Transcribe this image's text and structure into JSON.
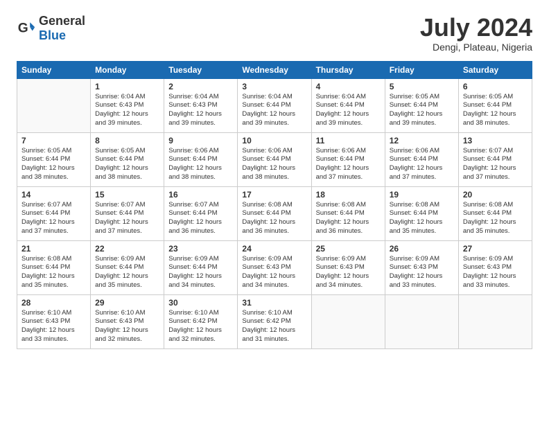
{
  "header": {
    "logo_general": "General",
    "logo_blue": "Blue",
    "main_title": "July 2024",
    "subtitle": "Dengi, Plateau, Nigeria"
  },
  "calendar": {
    "weekdays": [
      "Sunday",
      "Monday",
      "Tuesday",
      "Wednesday",
      "Thursday",
      "Friday",
      "Saturday"
    ],
    "weeks": [
      [
        {
          "day": "",
          "info": ""
        },
        {
          "day": "1",
          "info": "Sunrise: 6:04 AM\nSunset: 6:43 PM\nDaylight: 12 hours\nand 39 minutes."
        },
        {
          "day": "2",
          "info": "Sunrise: 6:04 AM\nSunset: 6:43 PM\nDaylight: 12 hours\nand 39 minutes."
        },
        {
          "day": "3",
          "info": "Sunrise: 6:04 AM\nSunset: 6:44 PM\nDaylight: 12 hours\nand 39 minutes."
        },
        {
          "day": "4",
          "info": "Sunrise: 6:04 AM\nSunset: 6:44 PM\nDaylight: 12 hours\nand 39 minutes."
        },
        {
          "day": "5",
          "info": "Sunrise: 6:05 AM\nSunset: 6:44 PM\nDaylight: 12 hours\nand 39 minutes."
        },
        {
          "day": "6",
          "info": "Sunrise: 6:05 AM\nSunset: 6:44 PM\nDaylight: 12 hours\nand 38 minutes."
        }
      ],
      [
        {
          "day": "7",
          "info": "Sunrise: 6:05 AM\nSunset: 6:44 PM\nDaylight: 12 hours\nand 38 minutes."
        },
        {
          "day": "8",
          "info": "Sunrise: 6:05 AM\nSunset: 6:44 PM\nDaylight: 12 hours\nand 38 minutes."
        },
        {
          "day": "9",
          "info": "Sunrise: 6:06 AM\nSunset: 6:44 PM\nDaylight: 12 hours\nand 38 minutes."
        },
        {
          "day": "10",
          "info": "Sunrise: 6:06 AM\nSunset: 6:44 PM\nDaylight: 12 hours\nand 38 minutes."
        },
        {
          "day": "11",
          "info": "Sunrise: 6:06 AM\nSunset: 6:44 PM\nDaylight: 12 hours\nand 37 minutes."
        },
        {
          "day": "12",
          "info": "Sunrise: 6:06 AM\nSunset: 6:44 PM\nDaylight: 12 hours\nand 37 minutes."
        },
        {
          "day": "13",
          "info": "Sunrise: 6:07 AM\nSunset: 6:44 PM\nDaylight: 12 hours\nand 37 minutes."
        }
      ],
      [
        {
          "day": "14",
          "info": "Sunrise: 6:07 AM\nSunset: 6:44 PM\nDaylight: 12 hours\nand 37 minutes."
        },
        {
          "day": "15",
          "info": "Sunrise: 6:07 AM\nSunset: 6:44 PM\nDaylight: 12 hours\nand 37 minutes."
        },
        {
          "day": "16",
          "info": "Sunrise: 6:07 AM\nSunset: 6:44 PM\nDaylight: 12 hours\nand 36 minutes."
        },
        {
          "day": "17",
          "info": "Sunrise: 6:08 AM\nSunset: 6:44 PM\nDaylight: 12 hours\nand 36 minutes."
        },
        {
          "day": "18",
          "info": "Sunrise: 6:08 AM\nSunset: 6:44 PM\nDaylight: 12 hours\nand 36 minutes."
        },
        {
          "day": "19",
          "info": "Sunrise: 6:08 AM\nSunset: 6:44 PM\nDaylight: 12 hours\nand 35 minutes."
        },
        {
          "day": "20",
          "info": "Sunrise: 6:08 AM\nSunset: 6:44 PM\nDaylight: 12 hours\nand 35 minutes."
        }
      ],
      [
        {
          "day": "21",
          "info": "Sunrise: 6:08 AM\nSunset: 6:44 PM\nDaylight: 12 hours\nand 35 minutes."
        },
        {
          "day": "22",
          "info": "Sunrise: 6:09 AM\nSunset: 6:44 PM\nDaylight: 12 hours\nand 35 minutes."
        },
        {
          "day": "23",
          "info": "Sunrise: 6:09 AM\nSunset: 6:44 PM\nDaylight: 12 hours\nand 34 minutes."
        },
        {
          "day": "24",
          "info": "Sunrise: 6:09 AM\nSunset: 6:43 PM\nDaylight: 12 hours\nand 34 minutes."
        },
        {
          "day": "25",
          "info": "Sunrise: 6:09 AM\nSunset: 6:43 PM\nDaylight: 12 hours\nand 34 minutes."
        },
        {
          "day": "26",
          "info": "Sunrise: 6:09 AM\nSunset: 6:43 PM\nDaylight: 12 hours\nand 33 minutes."
        },
        {
          "day": "27",
          "info": "Sunrise: 6:09 AM\nSunset: 6:43 PM\nDaylight: 12 hours\nand 33 minutes."
        }
      ],
      [
        {
          "day": "28",
          "info": "Sunrise: 6:10 AM\nSunset: 6:43 PM\nDaylight: 12 hours\nand 33 minutes."
        },
        {
          "day": "29",
          "info": "Sunrise: 6:10 AM\nSunset: 6:43 PM\nDaylight: 12 hours\nand 32 minutes."
        },
        {
          "day": "30",
          "info": "Sunrise: 6:10 AM\nSunset: 6:42 PM\nDaylight: 12 hours\nand 32 minutes."
        },
        {
          "day": "31",
          "info": "Sunrise: 6:10 AM\nSunset: 6:42 PM\nDaylight: 12 hours\nand 31 minutes."
        },
        {
          "day": "",
          "info": ""
        },
        {
          "day": "",
          "info": ""
        },
        {
          "day": "",
          "info": ""
        }
      ]
    ]
  }
}
